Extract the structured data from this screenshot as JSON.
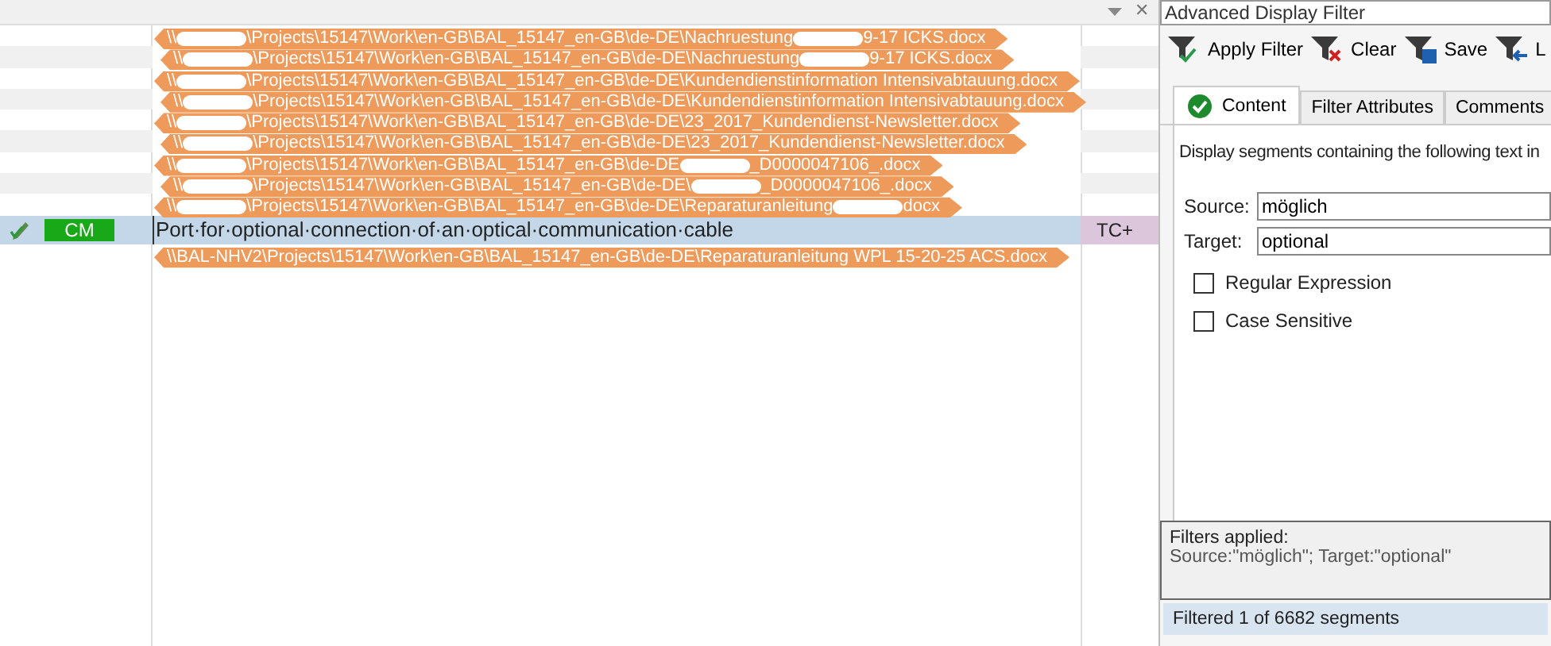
{
  "editor": {
    "close_glyph": "✕",
    "rows": [
      {
        "kind": "tag",
        "parts": [
          {
            "kind": "text",
            "text": "\\\\"
          },
          {
            "kind": "redacted"
          },
          {
            "kind": "text",
            "text": "\\Projects\\15147\\Work\\en-GB\\BAL_15147_en-GB\\de-DE\\Nachruestung "
          },
          {
            "kind": "redacted"
          },
          {
            "kind": "text",
            "text": "9-17 ICKS.docx"
          }
        ]
      },
      {
        "kind": "tag",
        "parts": [
          {
            "kind": "text",
            "text": "\\\\"
          },
          {
            "kind": "redacted"
          },
          {
            "kind": "text",
            "text": "\\Projects\\15147\\Work\\en-GB\\BAL_15147_en-GB\\de-DE\\Nachruestung "
          },
          {
            "kind": "redacted"
          },
          {
            "kind": "text",
            "text": " 9-17 ICKS.docx"
          }
        ]
      },
      {
        "kind": "tag",
        "parts": [
          {
            "kind": "text",
            "text": "\\\\"
          },
          {
            "kind": "redacted"
          },
          {
            "kind": "text",
            "text": "\\Projects\\15147\\Work\\en-GB\\BAL_15147_en-GB\\de-DE\\Kundendienstinformation Intensivabtauung.docx"
          }
        ]
      },
      {
        "kind": "tag",
        "parts": [
          {
            "kind": "text",
            "text": "\\\\"
          },
          {
            "kind": "redacted"
          },
          {
            "kind": "text",
            "text": "\\Projects\\15147\\Work\\en-GB\\BAL_15147_en-GB\\de-DE\\Kundendienstinformation Intensivabtauung.docx"
          }
        ]
      },
      {
        "kind": "tag",
        "parts": [
          {
            "kind": "text",
            "text": "\\\\"
          },
          {
            "kind": "redacted"
          },
          {
            "kind": "text",
            "text": "\\Projects\\15147\\Work\\en-GB\\BAL_15147_en-GB\\de-DE\\23_2017_Kundendienst-Newsletter.docx"
          }
        ]
      },
      {
        "kind": "tag",
        "parts": [
          {
            "kind": "text",
            "text": "\\\\"
          },
          {
            "kind": "redacted"
          },
          {
            "kind": "text",
            "text": "\\Projects\\15147\\Work\\en-GB\\BAL_15147_en-GB\\de-DE\\23_2017_Kundendienst-Newsletter.docx"
          }
        ]
      },
      {
        "kind": "tag",
        "parts": [
          {
            "kind": "text",
            "text": "\\\\"
          },
          {
            "kind": "redacted"
          },
          {
            "kind": "text",
            "text": "\\Projects\\15147\\Work\\en-GB\\BAL_15147_en-GB\\de-DE"
          },
          {
            "kind": "redacted"
          },
          {
            "kind": "text",
            "text": "_D0000047106_.docx"
          }
        ]
      },
      {
        "kind": "tag",
        "parts": [
          {
            "kind": "text",
            "text": "\\\\"
          },
          {
            "kind": "redacted"
          },
          {
            "kind": "text",
            "text": "\\Projects\\15147\\Work\\en-GB\\BAL_15147_en-GB\\de-DE\\"
          },
          {
            "kind": "redacted"
          },
          {
            "kind": "text",
            "text": "_D0000047106_.docx"
          }
        ]
      },
      {
        "kind": "tag",
        "parts": [
          {
            "kind": "text",
            "text": "\\\\"
          },
          {
            "kind": "redacted"
          },
          {
            "kind": "text",
            "text": "\\Projects\\15147\\Work\\en-GB\\BAL_15147_en-GB\\de-DE\\Reparaturanleitung "
          },
          {
            "kind": "redacted"
          },
          {
            "kind": "text",
            "text": "docx"
          }
        ]
      },
      {
        "kind": "segment",
        "selected": true,
        "status": "CM",
        "text": "Port·for·optional·connection·of·an·optical·communication·cable",
        "match": "TC+"
      },
      {
        "kind": "tag",
        "parts": [
          {
            "kind": "text",
            "text": "\\\\BAL-NHV2\\Projects\\15147\\Work\\en-GB\\BAL_15147_en-GB\\de-DE\\Reparaturanleitung WPL 15-20-25 ACS.docx"
          }
        ]
      }
    ]
  },
  "filter_panel": {
    "title": "Advanced Display Filter",
    "toolbar": [
      {
        "kind": "apply",
        "label": "Apply Filter"
      },
      {
        "kind": "clear",
        "label": "Clear"
      },
      {
        "kind": "save",
        "label": "Save"
      },
      {
        "kind": "load",
        "label": "L"
      }
    ],
    "tabs": [
      {
        "label": "Content",
        "selected": true
      },
      {
        "label": "Filter Attributes",
        "selected": false
      },
      {
        "label": "Comments",
        "selected": false
      }
    ],
    "description": "Display segments containing the following text in",
    "fields": [
      {
        "label": "Source:",
        "value": "möglich"
      },
      {
        "label": "Target:",
        "value": "optional"
      }
    ],
    "checkboxes": [
      {
        "label": "Regular Expression",
        "checked": false
      },
      {
        "label": "Case Sensitive",
        "checked": false
      }
    ],
    "applied_title": "Filters applied:",
    "applied_text": "Source:\"möglich\"; Target:\"optional\"",
    "status": "Filtered 1 of 6682 segments"
  }
}
